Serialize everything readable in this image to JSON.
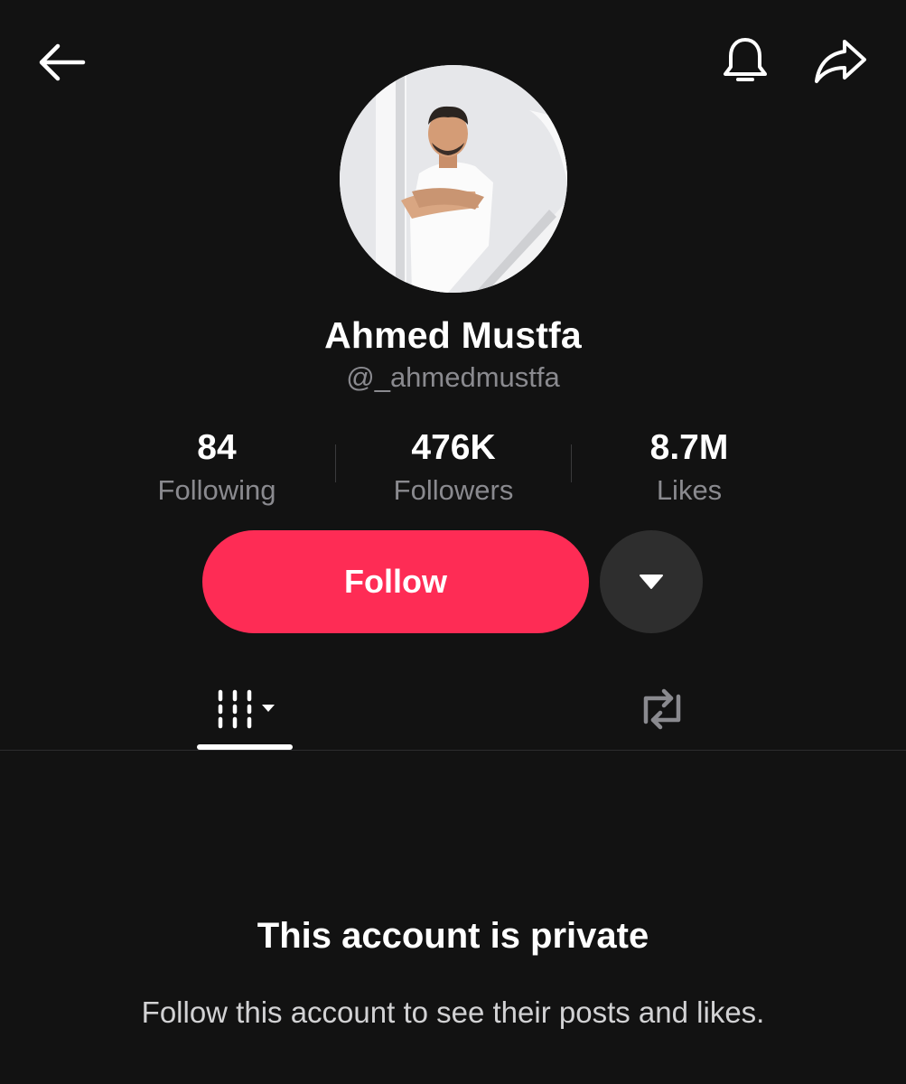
{
  "header": {
    "back_icon": "arrow-left-icon",
    "bell_icon": "bell-icon",
    "share_icon": "share-arrow-icon"
  },
  "profile": {
    "avatar": "profile-photo",
    "display_name": "Ahmed Mustfa",
    "username": "@_ahmedmustfa"
  },
  "stats": [
    {
      "value": "84",
      "label": "Following"
    },
    {
      "value": "476K",
      "label": "Followers"
    },
    {
      "value": "8.7M",
      "label": "Likes"
    }
  ],
  "actions": {
    "follow_label": "Follow",
    "follow_color": "#fe2c55",
    "more_icon": "caret-down-icon"
  },
  "tabs": [
    {
      "icon": "videos-grid-icon",
      "active": true
    },
    {
      "icon": "repost-icon",
      "active": false
    }
  ],
  "private_notice": {
    "title": "This account is private",
    "description": "Follow this account to see their posts and likes."
  },
  "colors": {
    "background": "#121212",
    "secondary_text": "#8a8a8f"
  }
}
